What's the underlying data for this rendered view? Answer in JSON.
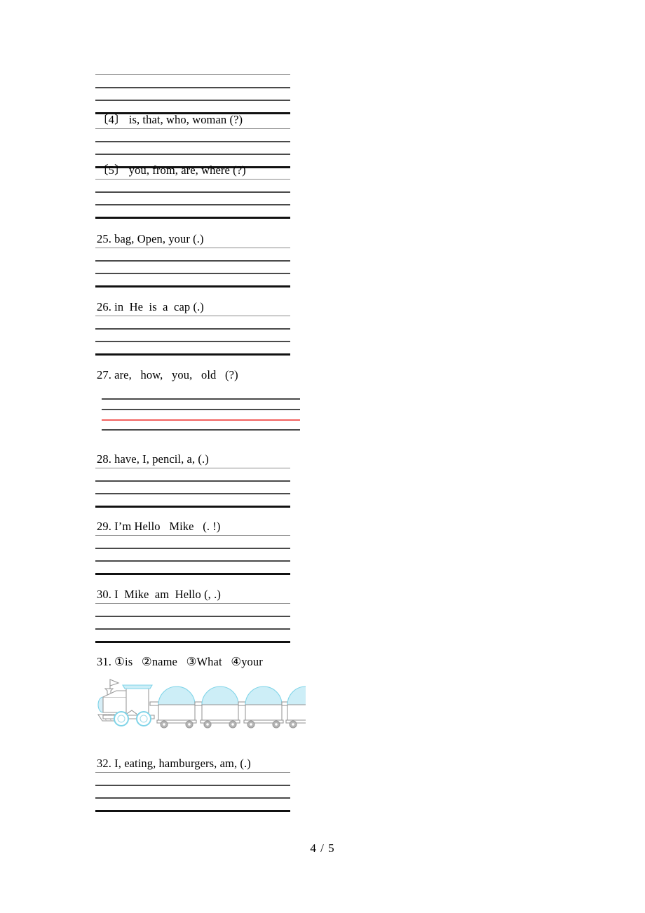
{
  "document": {
    "type": "worksheet",
    "subject": "English word-ordering exercise",
    "page_footer": "4 / 5"
  },
  "top_partial_lines": {
    "note": "continuation of previous item's ruled answer lines",
    "line_count": 4
  },
  "items": [
    {
      "id": "item-4",
      "number": "〔4〕",
      "text": "〔4〕 is, that, who, woman (?)",
      "answer_lines": 4,
      "line_style": "standard"
    },
    {
      "id": "item-5",
      "number": "〔5〕",
      "text": "〔5〕 you, from, are, where (?)",
      "answer_lines": 4,
      "line_style": "standard"
    },
    {
      "id": "item-25",
      "number": "25.",
      "text": "25. bag, Open, your (.)",
      "answer_lines": 4,
      "line_style": "standard"
    },
    {
      "id": "item-26",
      "number": "26.",
      "text": "26. in  He  is  a  cap (.)",
      "answer_lines": 4,
      "line_style": "standard"
    },
    {
      "id": "item-27",
      "number": "27.",
      "text": "27. are,   how,   you,   old   (?)",
      "answer_lines": 4,
      "line_style": "indented-red",
      "red_line_index": 2
    },
    {
      "id": "item-28",
      "number": "28.",
      "text": "28. have, I, pencil, a, (.)",
      "answer_lines": 4,
      "line_style": "standard"
    },
    {
      "id": "item-29",
      "number": "29.",
      "text": "29. I’m Hello   Mike   (. !)",
      "answer_lines": 4,
      "line_style": "standard"
    },
    {
      "id": "item-30",
      "number": "30.",
      "text": "30. I  Mike  am  Hello (, .)",
      "answer_lines": 4,
      "line_style": "standard"
    },
    {
      "id": "item-31",
      "number": "31.",
      "text": "31. ①is   ②name   ③What   ④your",
      "choices": [
        {
          "marker": "①",
          "word": "is"
        },
        {
          "marker": "②",
          "word": "name"
        },
        {
          "marker": "③",
          "word": "What"
        },
        {
          "marker": "④",
          "word": "your"
        }
      ],
      "illustration": "train-illustration",
      "answer_lines": 0,
      "line_style": "none"
    },
    {
      "id": "item-32",
      "number": "32.",
      "text": "32. I, eating, hamburgers, am, (.)",
      "answer_lines": 4,
      "line_style": "standard"
    }
  ],
  "illustration": {
    "name": "train-illustration",
    "description": "steam locomotive pulling four domed cars",
    "car_count": 4,
    "colors": {
      "dome_fill": "#c9ecf5",
      "outline": "#9a9a9a",
      "wheel": "#a8a8a8",
      "accent_blue": "#7fd4e8"
    }
  },
  "colors": {
    "page_background": "#ffffff",
    "text": "#000000",
    "rule_thin": "#8a8a8a",
    "rule_medium": "#4a4a4a",
    "rule_thick": "#111111",
    "rule_red": "#f2625f"
  }
}
